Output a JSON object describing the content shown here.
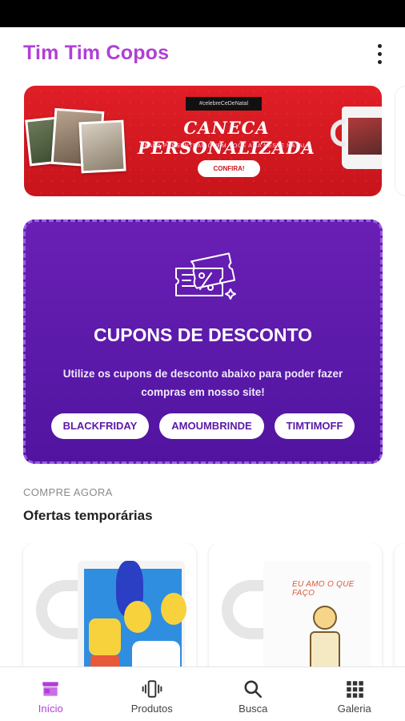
{
  "app": {
    "title": "Tim Tim Copos",
    "accent_color": "#b03fd6"
  },
  "banner": {
    "hashtag": "#celebreCeDeNatal",
    "title": "CANECA PERSONALIZADA",
    "subtitle": "PARA PRESENTEAR QUEM VOCÊ AMA NESTE NATAL!",
    "button_label": "CONFIRA!",
    "color": "#e01e26"
  },
  "coupons": {
    "icon": "ticket-percent-icon",
    "title": "CUPONS DE DESCONTO",
    "description": "Utilize os cupons de desconto abaixo para poder fazer compras em nosso site!",
    "codes": [
      "BLACKFRIDAY",
      "AMOUMBRINDE",
      "TIMTIMOFF"
    ],
    "color": "#5a19a8"
  },
  "offers": {
    "overline": "COMPRE AGORA",
    "title": "Ofertas temporárias",
    "products": [
      {
        "art": "simpsons-mug"
      },
      {
        "art": "eu-amo-o-que-faco-mug",
        "text": "EU AMO O QUE FAÇO"
      },
      {
        "art": "partial-card"
      }
    ]
  },
  "bottom_nav": {
    "items": [
      {
        "label": "Início",
        "icon": "store-icon",
        "active": true
      },
      {
        "label": "Produtos",
        "icon": "vibration-phone-icon",
        "active": false
      },
      {
        "label": "Busca",
        "icon": "search-icon",
        "active": false
      },
      {
        "label": "Galeria",
        "icon": "grid-icon",
        "active": false
      }
    ]
  }
}
